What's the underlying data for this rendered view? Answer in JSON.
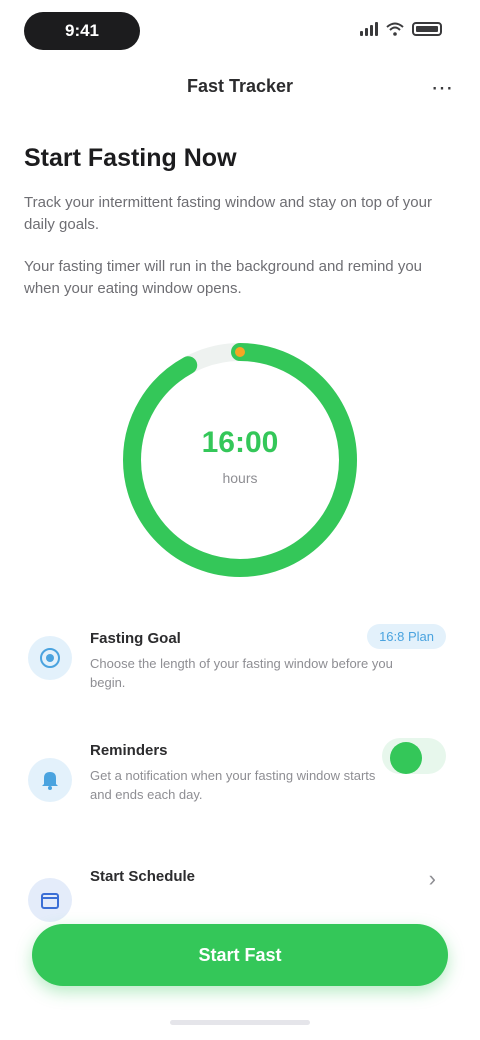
{
  "status_bar": {
    "time": "9:41"
  },
  "nav": {
    "title": "Fast Tracker",
    "more_icon": "more-icon"
  },
  "intro": {
    "heading": "Start Fasting Now",
    "paragraph_1": "Track your intermittent fasting window and stay on top of your daily goals.",
    "paragraph_2": "Your fasting timer will run in the background and remind you when your eating window opens."
  },
  "ring": {
    "progress": 0.92,
    "value": "16:00",
    "unit": "hours",
    "color": "#34c759",
    "track_color": "#eef2f0"
  },
  "rows": [
    {
      "title": "Fasting Goal",
      "description": "Choose the length of your fasting window before you begin.",
      "action_label": "16:8 Plan",
      "icon": "target-icon",
      "icon_color": "#4aa3df"
    },
    {
      "title": "Reminders",
      "description": "Get a notification when your fasting window starts and ends each day.",
      "toggle_on": true,
      "icon": "bell-icon",
      "icon_color": "#4aa3df"
    },
    {
      "title": "Start Schedule",
      "icon": "calendar-icon",
      "icon_color": "#3b6fd6"
    }
  ],
  "primary_button": {
    "label": "Start Fast"
  },
  "colors": {
    "accent": "#34c759",
    "link": "#4aa3df"
  }
}
